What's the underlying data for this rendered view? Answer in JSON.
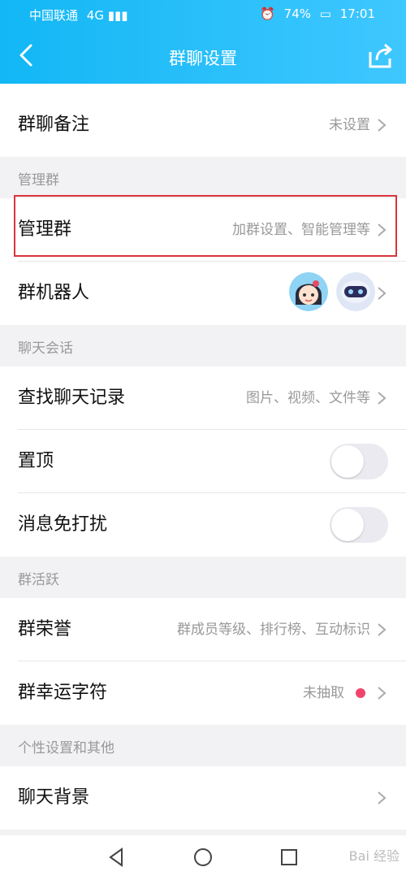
{
  "status": {
    "carrier": "中国联通",
    "network": "4G",
    "battery": "74%",
    "time": "17:01"
  },
  "nav": {
    "title": "群聊设置"
  },
  "rows": {
    "remark": {
      "label": "群聊备注",
      "value": "未设置"
    },
    "manage": {
      "label": "管理群",
      "value": "加群设置、智能管理等"
    },
    "robot": {
      "label": "群机器人"
    },
    "search": {
      "label": "查找聊天记录",
      "value": "图片、视频、文件等"
    },
    "pin": {
      "label": "置顶"
    },
    "mute": {
      "label": "消息免打扰"
    },
    "honor": {
      "label": "群荣誉",
      "value": "群成员等级、排行榜、互动标识"
    },
    "lucky": {
      "label": "群幸运字符",
      "value": "未抽取"
    },
    "background": {
      "label": "聊天背景"
    }
  },
  "sections": {
    "manage": "管理群",
    "chat": "聊天会话",
    "active": "群活跃",
    "other": "个性设置和其他"
  },
  "toggles": {
    "pin": "off",
    "mute": "off"
  },
  "colors": {
    "accent": "#12b7f5",
    "highlight": "#d9353b",
    "badge": "#f1446c"
  },
  "icons": [
    "back-icon",
    "share-icon",
    "chevron-right-icon",
    "robot-avatar-icon",
    "girl-avatar-icon",
    "nav-back-icon",
    "nav-home-icon",
    "nav-recent-icon"
  ],
  "watermark": "Bai 经验"
}
